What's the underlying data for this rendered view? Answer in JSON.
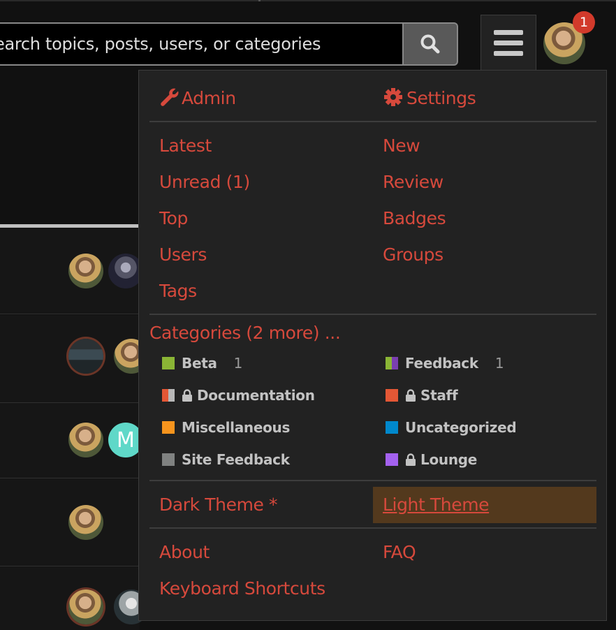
{
  "header": {
    "search_placeholder": "earch topics, posts, users, or categories",
    "search_button_icon": "search-icon",
    "menu_button_icon": "hamburger-icon",
    "notification_count": "1"
  },
  "menu": {
    "admin_label": "Admin",
    "settings_label": "Settings",
    "nav_left": [
      "Latest",
      "Unread (1)",
      "Top",
      "Users",
      "Tags"
    ],
    "nav_right": [
      "New",
      "Review",
      "Badges",
      "Groups"
    ],
    "categories_heading": "Categories (2 more) ...",
    "categories": [
      {
        "name": "Beta",
        "count": "1",
        "colors": [
          "#8ab535"
        ]
      },
      {
        "name": "Feedback",
        "count": "1",
        "colors": [
          "#8ab535",
          "#7a3fb0"
        ]
      },
      {
        "name": "Documentation",
        "count": "",
        "locked": true,
        "colors": [
          "#e45735",
          "#b8b8b8"
        ]
      },
      {
        "name": "Staff",
        "count": "",
        "locked": true,
        "colors": [
          "#e45735"
        ]
      },
      {
        "name": "Miscellaneous",
        "count": "",
        "colors": [
          "#f7941d"
        ]
      },
      {
        "name": "Uncategorized",
        "count": "",
        "colors": [
          "#0088cc"
        ]
      },
      {
        "name": "Site Feedback",
        "count": "",
        "colors": [
          "#808281"
        ]
      },
      {
        "name": "Lounge",
        "count": "",
        "locked": true,
        "colors": [
          "#a461ef"
        ]
      }
    ],
    "dark_theme_label": "Dark Theme *",
    "light_theme_label": "Light Theme",
    "about_label": "About",
    "faq_label": "FAQ",
    "keyboard_shortcuts_label": "Keyboard Shortcuts"
  },
  "colors": {
    "link": "#d6493c",
    "menu_bg": "#222222",
    "highlight_bg": "#53391d",
    "badge": "#d23a2b"
  },
  "background_rows": {
    "letter_avatar": "M"
  }
}
